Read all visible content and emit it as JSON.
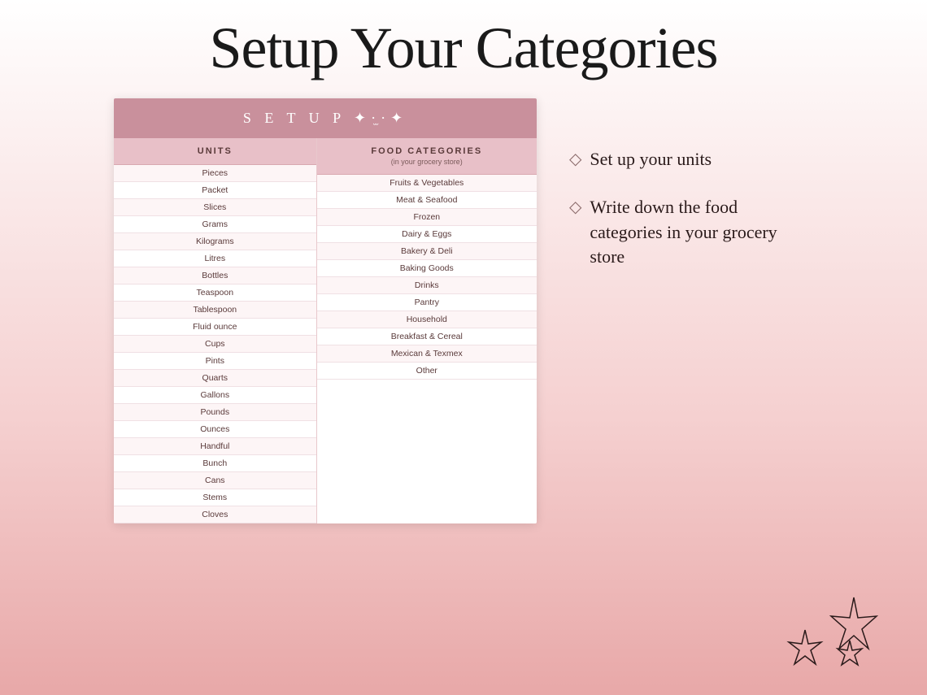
{
  "page": {
    "title": "Setup Your Categories",
    "background": "linear-gradient to bottom white to pink"
  },
  "document": {
    "header": "S E T U P ✦·̫·✦",
    "units_column": {
      "title": "UNITS",
      "rows": [
        "Pieces",
        "Packet",
        "Slices",
        "Grams",
        "Kilograms",
        "Litres",
        "Bottles",
        "Teaspoon",
        "Tablespoon",
        "Fluid ounce",
        "Cups",
        "Pints",
        "Quarts",
        "Gallons",
        "Pounds",
        "Ounces",
        "Handful",
        "Bunch",
        "Cans",
        "Stems",
        "Cloves"
      ]
    },
    "categories_column": {
      "title": "FOOD CATEGORIES",
      "subtitle": "(in your grocery store)",
      "rows": [
        "Fruits & Vegetables",
        "Meat & Seafood",
        "Frozen",
        "Dairy & Eggs",
        "Bakery & Deli",
        "Baking Goods",
        "Drinks",
        "Pantry",
        "Household",
        "Breakfast & Cereal",
        "Mexican & Texmex",
        "Other"
      ]
    }
  },
  "bullets": [
    {
      "icon": "◇",
      "text": "Set up your units"
    },
    {
      "icon": "◇",
      "text": "Write down the food categories in your grocery store"
    }
  ]
}
